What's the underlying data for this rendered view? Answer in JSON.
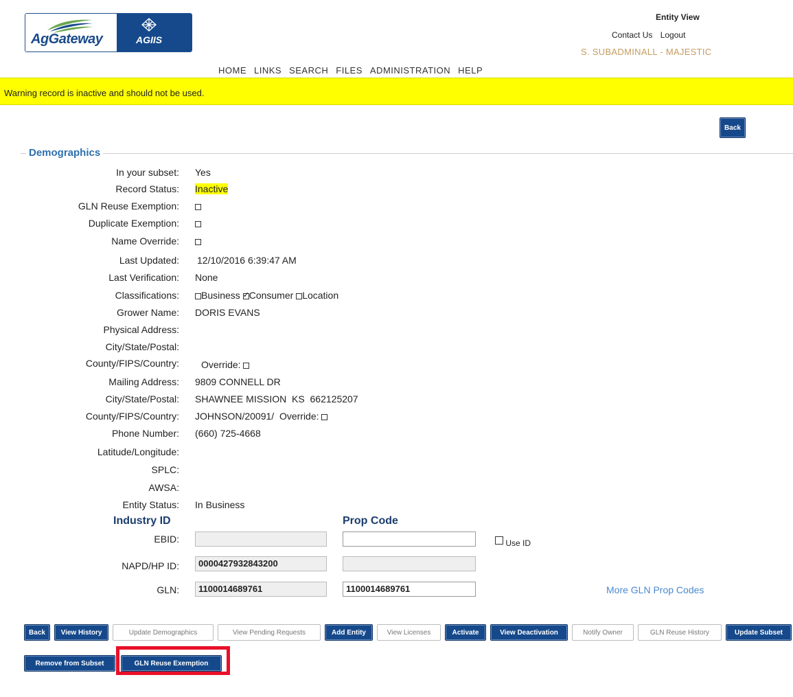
{
  "logo": {
    "ag_text": "AgGateway",
    "agiis_text": "AGIIS"
  },
  "nav": [
    "HOME",
    "LINKS",
    "SEARCH",
    "FILES",
    "ADMINISTRATION",
    "HELP"
  ],
  "top_right": {
    "title": "Entity View",
    "contact": "Contact Us",
    "logout": "Logout",
    "user": "S. SUBADMINALL - MAJESTIC"
  },
  "warning": "Warning record is inactive and should not be used.",
  "back_top": "Back",
  "demographics": {
    "legend": "Demographics",
    "labels": {
      "subset": "In your subset:",
      "status": "Record Status:",
      "gln_reuse": "GLN Reuse Exemption:",
      "dup": "Duplicate Exemption:",
      "name_override": "Name Override:",
      "last_updated": "Last Updated:",
      "last_verification": "Last Verification:",
      "classifications": "Classifications:",
      "grower": "Grower Name:",
      "phys_addr": "Physical Address:",
      "city1": "City/State/Postal:",
      "county1": "County/FIPS/Country:",
      "mail_addr": "Mailing Address:",
      "city2": "City/State/Postal:",
      "county2": "County/FIPS/Country:",
      "phone": "Phone Number:",
      "latlong": "Latitude/Longitude:",
      "splc": "SPLC:",
      "awsa": "AWSA:",
      "entity_status": "Entity Status:",
      "ebid": "EBID:",
      "napd": "NAPD/HP ID:",
      "gln": "GLN:"
    },
    "values": {
      "subset": "Yes",
      "status": "Inactive",
      "last_updated": "12/10/2016 6:39:47 AM",
      "last_verification": "None",
      "class_business": "Business",
      "class_consumer": "Consumer",
      "class_location": "Location",
      "grower": "DORIS EVANS",
      "override": "Override:",
      "mail_addr": "9809 CONNELL DR",
      "city2": "SHAWNEE MISSION  KS  662125207",
      "county2": "JOHNSON/20091/  Override:",
      "phone": "(660) 725-4668",
      "entity_status": "In Business"
    },
    "industry_id_header": "Industry ID",
    "prop_code_header": "Prop Code",
    "use_id": "Use ID",
    "ebid_value": "",
    "ebid_prop": "",
    "napd_value": "0000427932843200",
    "napd_prop": "",
    "gln_value": "1100014689761",
    "gln_prop": "1100014689761",
    "more_gln": "More GLN Prop Codes"
  },
  "buttons": {
    "back": "Back",
    "view_history": "View History",
    "update_demographics": "Update Demographics",
    "view_pending": "View Pending Requests",
    "add_entity": "Add Entity",
    "view_licenses": "View Licenses",
    "activate": "Activate",
    "view_deactivation": "View Deactivation",
    "notify_owner": "Notify Owner",
    "gln_reuse_history": "GLN Reuse History",
    "update_subset": "Update Subset",
    "remove_subset": "Remove from Subset",
    "gln_reuse_exemption": "GLN Reuse Exemption"
  }
}
